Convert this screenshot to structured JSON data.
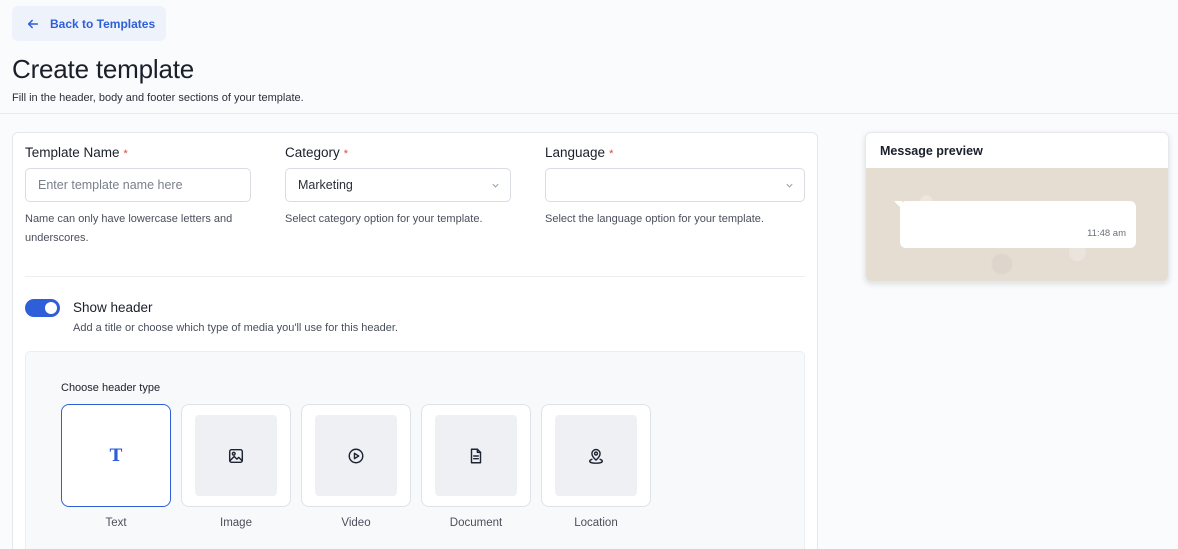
{
  "back_button": {
    "label": "Back to Templates"
  },
  "page": {
    "title": "Create template",
    "subtitle": "Fill in the header, body and footer sections of your template."
  },
  "form": {
    "template_name": {
      "label": "Template Name",
      "required_mark": "*",
      "placeholder": "Enter template name here",
      "value": "",
      "help": "Name can only have lowercase letters and underscores."
    },
    "category": {
      "label": "Category",
      "required_mark": "*",
      "value": "Marketing",
      "help": "Select category option for your template."
    },
    "language": {
      "label": "Language",
      "required_mark": "*",
      "value": "",
      "help": "Select the language option for your template."
    }
  },
  "header_toggle": {
    "label": "Show header",
    "description": "Add a title or choose which type of media you'll use for this header.",
    "enabled": true
  },
  "header_types": {
    "label": "Choose header type",
    "selected": "Text",
    "options": [
      {
        "name": "Text",
        "icon": "text-t-icon"
      },
      {
        "name": "Image",
        "icon": "image-icon"
      },
      {
        "name": "Video",
        "icon": "play-circle-icon"
      },
      {
        "name": "Document",
        "icon": "document-icon"
      },
      {
        "name": "Location",
        "icon": "location-pin-icon"
      }
    ]
  },
  "preview": {
    "title": "Message preview",
    "time": "11:48 am"
  },
  "colors": {
    "accent": "#2f5fd8",
    "required": "#e0443d",
    "chat_background": "#e5ddd2"
  }
}
